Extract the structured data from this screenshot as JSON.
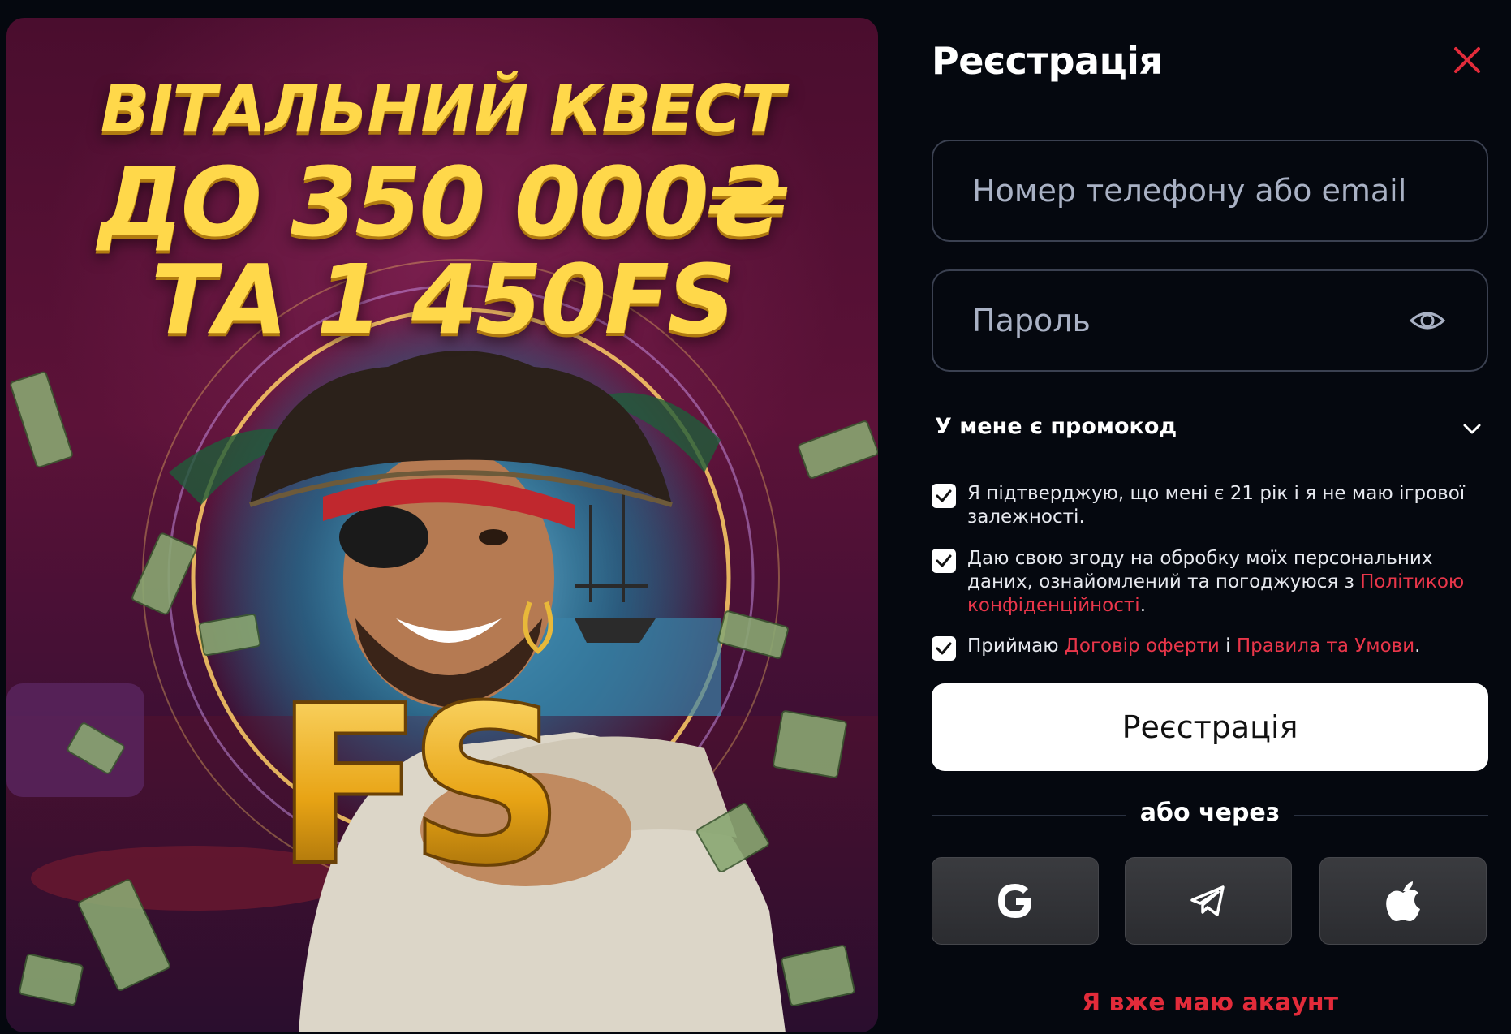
{
  "promo": {
    "line1": "ВІТАЛЬНИЙ КВЕСТ",
    "line2": "ДО 350 000₴",
    "line3": "ТА 1 450FS",
    "badge": "FS"
  },
  "form": {
    "title": "Реєстрація",
    "close_icon": "close-icon",
    "login_placeholder": "Номер телефону або email",
    "password_placeholder": "Пароль",
    "password_icon": "eye-icon",
    "promo_label": "У мене є промокод",
    "checkboxes": [
      {
        "checked": true,
        "text": "Я підтверджую, що мені є 21 рік і я не маю ігрової залежності."
      },
      {
        "checked": true,
        "text_before": "Даю свою згоду на обробку моїх персональних даних, ознайомлений та погоджуюся з ",
        "link": "Політикою конфіденційності",
        "text_after": "."
      },
      {
        "checked": true,
        "text_before": "Приймаю ",
        "link1": "Договір оферти",
        "middle": " і ",
        "link2": "Правила та Умови",
        "text_after": "."
      }
    ],
    "submit_label": "Реєстрація",
    "or_label": "або через",
    "social": [
      "google-icon",
      "telegram-icon",
      "apple-icon"
    ],
    "login_link": "Я вже маю акаунт"
  },
  "colors": {
    "background": "#05080f",
    "accent_red": "#e22b3a",
    "link_red": "#e9364a",
    "headline_gold": "#ffd84a"
  }
}
